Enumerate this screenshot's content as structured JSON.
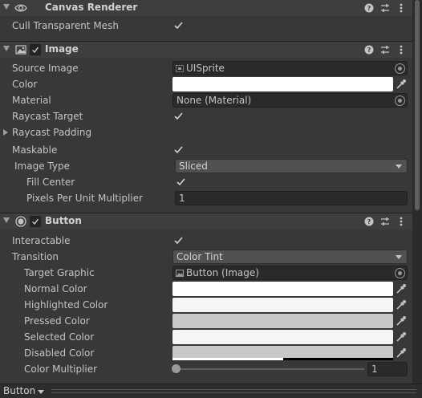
{
  "canvas_renderer": {
    "title": "Canvas Renderer",
    "cull_label": "Cull Transparent Mesh",
    "cull_checked": true
  },
  "image": {
    "title": "Image",
    "enabled": true,
    "source_image_label": "Source Image",
    "source_image_value": "UISprite",
    "color_label": "Color",
    "color_value": "#ffffff",
    "material_label": "Material",
    "material_value": "None (Material)",
    "raycast_target_label": "Raycast Target",
    "raycast_target_checked": true,
    "raycast_padding_label": "Raycast Padding",
    "maskable_label": "Maskable",
    "maskable_checked": true,
    "image_type_label": "Image Type",
    "image_type_value": "Sliced",
    "fill_center_label": "Fill Center",
    "fill_center_checked": true,
    "ppu_label": "Pixels Per Unit Multiplier",
    "ppu_value": "1"
  },
  "button": {
    "title": "Button",
    "enabled": true,
    "interactable_label": "Interactable",
    "interactable_checked": true,
    "transition_label": "Transition",
    "transition_value": "Color Tint",
    "target_graphic_label": "Target Graphic",
    "target_graphic_value": "Button (Image)",
    "normal_color_label": "Normal Color",
    "normal_color_value": "#ffffff",
    "highlighted_color_label": "Highlighted Color",
    "highlighted_color_value": "#f5f5f5",
    "pressed_color_label": "Pressed Color",
    "pressed_color_value": "#c8c8c8",
    "selected_color_label": "Selected Color",
    "selected_color_value": "#f5f5f5",
    "disabled_color_label": "Disabled Color",
    "disabled_color_value": "#c8c8c8",
    "disabled_color_alpha": 0.5,
    "color_multiplier_label": "Color Multiplier",
    "color_multiplier_value": "1",
    "color_multiplier_fraction": 0
  },
  "bottom_bar": {
    "label": "Button"
  },
  "icons": {
    "visibility": "eye-icon",
    "help": "help-icon",
    "presets": "presets-icon",
    "more": "more-menu-icon",
    "image_component": "image-component-icon",
    "button_component": "button-component-icon",
    "color_picker": "eyedropper-icon",
    "object_picker": "object-picker-icon"
  },
  "colors": {
    "background": "#383838",
    "header": "#3e3e3e",
    "field": "#2a2a2a",
    "dropdown": "#515151",
    "text": "#c4c4c4"
  }
}
